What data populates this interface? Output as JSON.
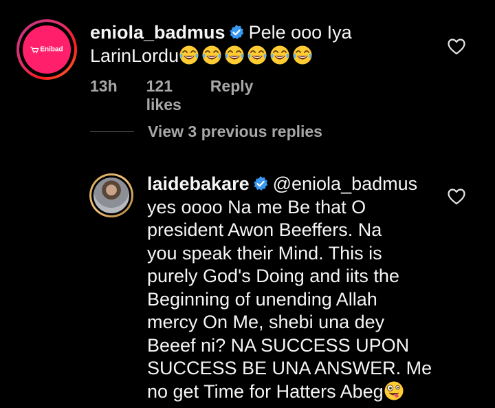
{
  "comment1": {
    "username": "eniola_badmus",
    "text_line1": "Pele ooo Iya",
    "text_line2": "LarinLordu",
    "emoji_count": 6,
    "time": "13h",
    "likes": "121 likes",
    "reply": "Reply",
    "avatar_logo": "Enibad"
  },
  "view_replies": "View 3 previous replies",
  "comment2": {
    "username": "laidebakare",
    "mention": "@eniola_badmus",
    "lines": [
      "yes oooo Na me Be that O",
      "president Awon Beeffers.  Na",
      "you speak their Mind. This is",
      "purely God's Doing and iits the",
      "Beginning of unending Allah",
      "mercy On Me, shebi una dey",
      "Beeef ni?  NA SUCCESS UPON",
      "SUCCESS BE UNA ANSWER. Me",
      "no get Time for Hatters Abeg"
    ]
  },
  "colors": {
    "background": "#000000",
    "text": "#f5f5f5",
    "muted": "#a8a8a8",
    "verified": "#3897f0",
    "avatar_brand": "#ff1f6b"
  },
  "icons": [
    "heart-icon",
    "verified-badge-icon",
    "laughing-emoji-icon",
    "zany-face-emoji-icon"
  ]
}
